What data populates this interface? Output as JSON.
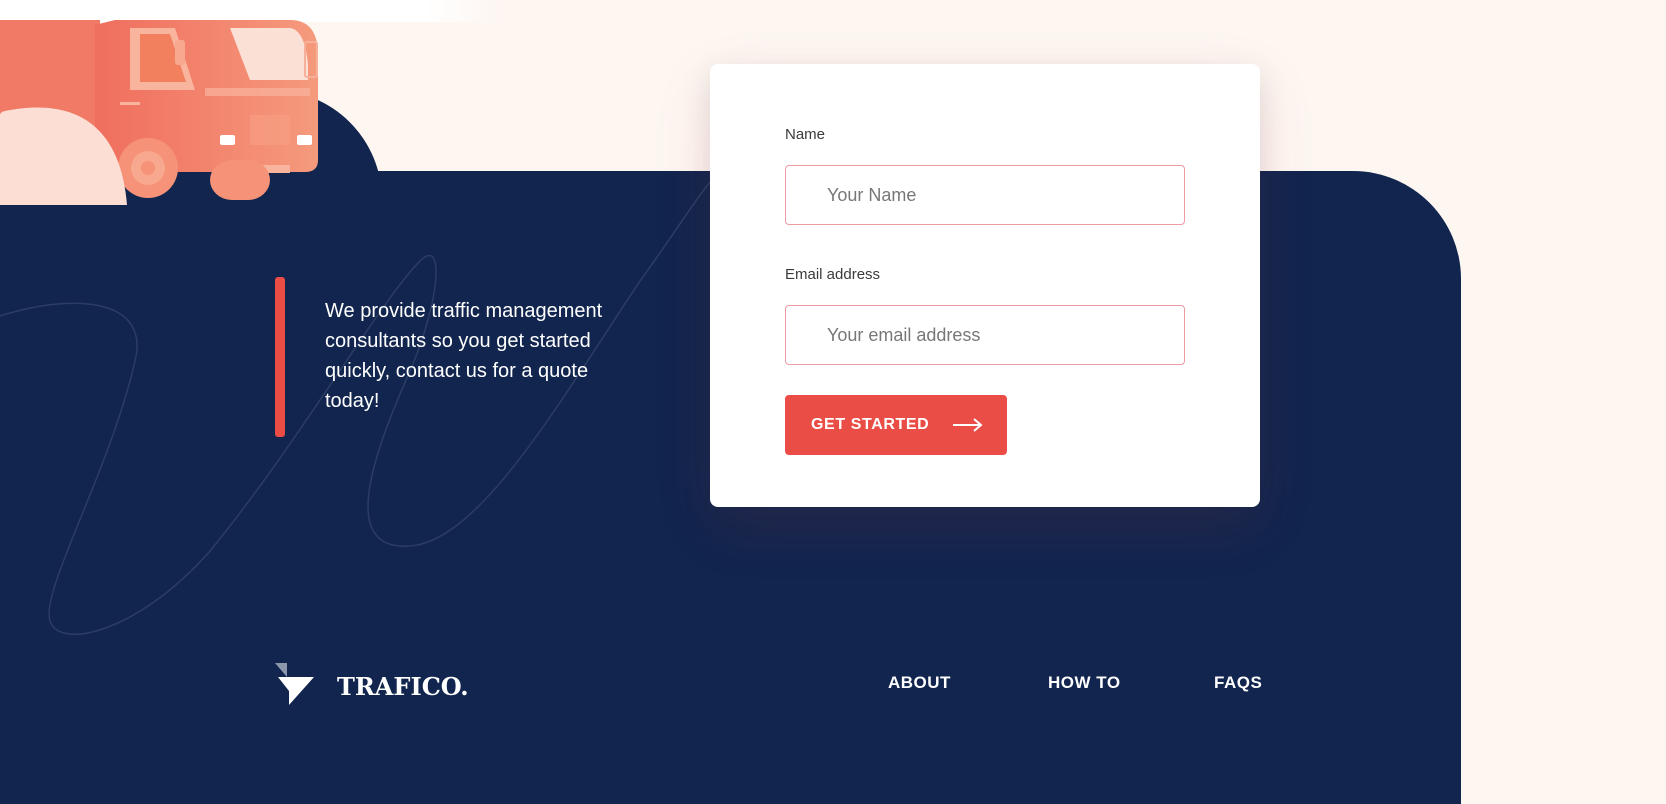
{
  "hero": {
    "tagline": "We provide traffic management consultants so you get started quickly, contact us for a quote today!"
  },
  "form": {
    "name_label": "Name",
    "name_placeholder": "Your Name",
    "name_value": "",
    "email_label": "Email address",
    "email_placeholder": "Your email address",
    "email_value": "",
    "submit_label": "GET STARTED",
    "submit_icon": "arrow-right-icon"
  },
  "footer": {
    "logo_text": "TRAFICO.",
    "logo_icon": "trafico-logo-icon",
    "links": [
      {
        "label": "ABOUT"
      },
      {
        "label": "HOW TO"
      },
      {
        "label": "FAQS"
      }
    ]
  },
  "colors": {
    "background": "#fdf6f1",
    "navy": "#11254e",
    "accent": "#ea4c46",
    "input_border": "#ee9ba1",
    "truck": "#f4906e"
  }
}
